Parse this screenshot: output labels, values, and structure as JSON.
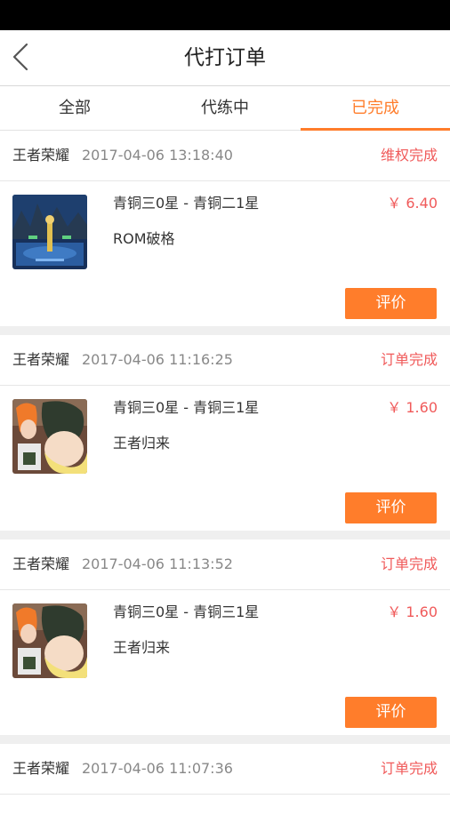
{
  "header": {
    "title": "代打订单",
    "back_icon": "chevron-left-icon"
  },
  "tabs": [
    {
      "label": "全部",
      "active": false
    },
    {
      "label": "代练中",
      "active": false
    },
    {
      "label": "已完成",
      "active": true
    }
  ],
  "colors": {
    "accent": "#ff7d2b",
    "status": "#f05a5a",
    "separator": "#efefef"
  },
  "orders": [
    {
      "game": "王者荣耀",
      "time": "2017-04-06 13:18:40",
      "status": "维权完成",
      "rank": "青铜三0星 - 青铜二1星",
      "price": "￥ 6.40",
      "subtitle": "ROM破格",
      "button": "评价",
      "thumb": "game-scene-thumbnail"
    },
    {
      "game": "王者荣耀",
      "time": "2017-04-06 11:16:25",
      "status": "订单完成",
      "rank": "青铜三0星 - 青铜三1星",
      "price": "￥ 1.60",
      "subtitle": "王者归来",
      "button": "评价",
      "thumb": "anime-character-thumbnail"
    },
    {
      "game": "王者荣耀",
      "time": "2017-04-06 11:13:52",
      "status": "订单完成",
      "rank": "青铜三0星 - 青铜三1星",
      "price": "￥ 1.60",
      "subtitle": "王者归来",
      "button": "评价",
      "thumb": "anime-character-thumbnail"
    },
    {
      "game": "王者荣耀",
      "time": "2017-04-06 11:07:36",
      "status": "订单完成"
    }
  ]
}
